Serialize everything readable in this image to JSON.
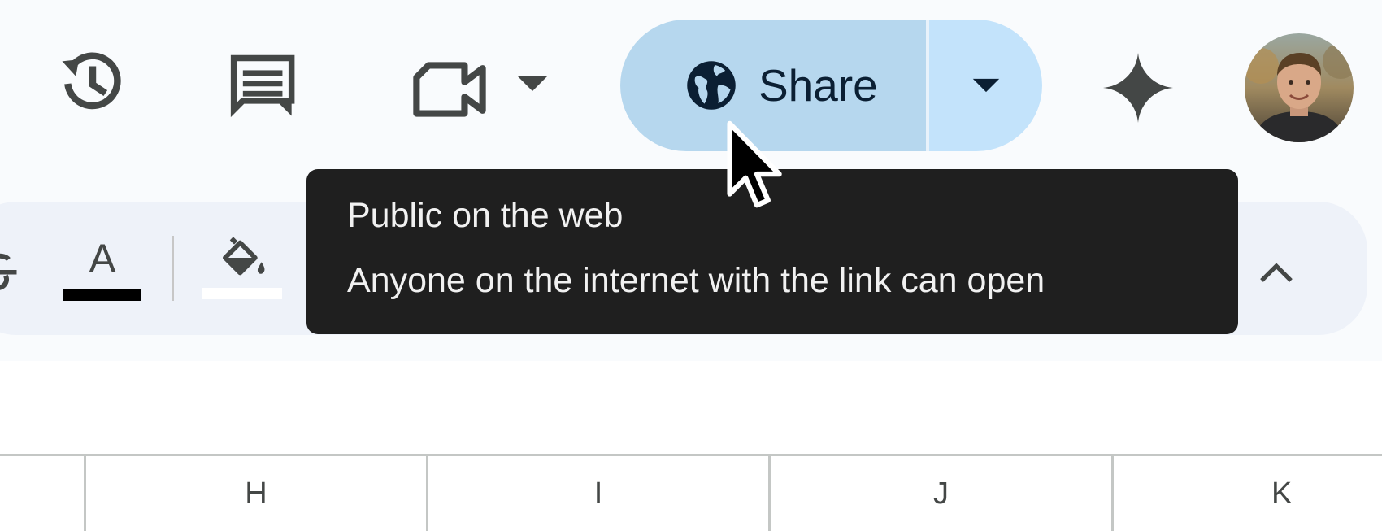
{
  "topbar": {
    "icons": {
      "history": "history-icon",
      "comments": "comments-icon",
      "meet": "video-camera-icon",
      "meet_dropdown": "caret-down-icon",
      "gemini": "sparkle-icon",
      "avatar": "user-avatar"
    },
    "share": {
      "label": "Share",
      "icon": "globe-icon",
      "dropdown_icon": "caret-down-icon"
    },
    "colors": {
      "share_bg": "#b6d7ee",
      "share_dropdown_bg": "#c3e3fb",
      "icon": "#444746"
    }
  },
  "tooltip": {
    "title": "Public on the web",
    "description": "Anyone on the internet with the link can open"
  },
  "toolbar": {
    "icons": [
      "strikethrough-icon",
      "text-color-icon",
      "fill-color-icon",
      "collapse-chevron-icon"
    ],
    "text_color_glyph": "A",
    "text_color_value": "#000000",
    "fill_color_value": "#ffffff"
  },
  "grid": {
    "columns": [
      "H",
      "I",
      "J",
      "K"
    ]
  }
}
